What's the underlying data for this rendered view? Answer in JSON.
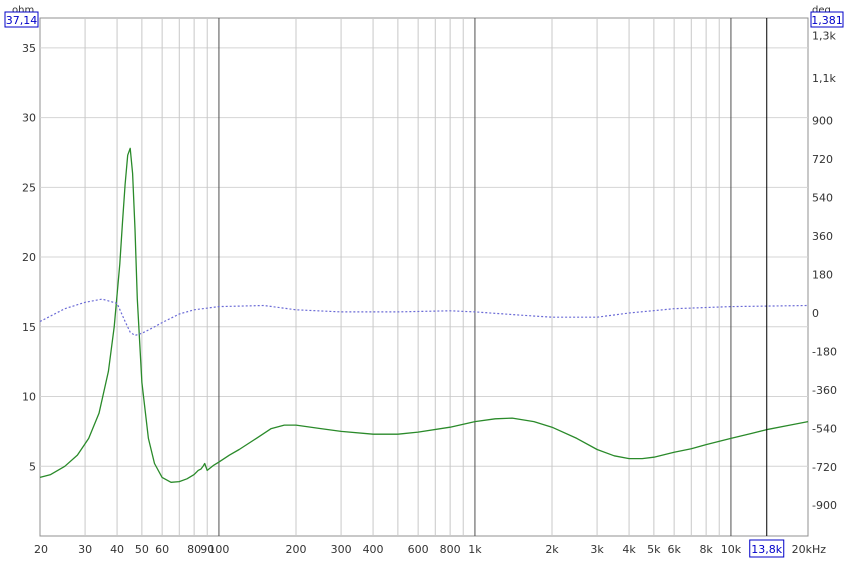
{
  "chart_data": {
    "type": "line",
    "x_axis": {
      "scale": "log",
      "range_hz": [
        20,
        20000
      ],
      "ticks": [
        {
          "value": 20,
          "label": "20"
        },
        {
          "value": 30,
          "label": "30"
        },
        {
          "value": 40,
          "label": "40"
        },
        {
          "value": 50,
          "label": "50"
        },
        {
          "value": 60,
          "label": "60"
        },
        {
          "value": 80,
          "label": "80"
        },
        {
          "value": 90,
          "label": "90"
        },
        {
          "value": 100,
          "label": "100"
        },
        {
          "value": 200,
          "label": "200"
        },
        {
          "value": 300,
          "label": "300"
        },
        {
          "value": 400,
          "label": "400"
        },
        {
          "value": 600,
          "label": "600"
        },
        {
          "value": 800,
          "label": "800"
        },
        {
          "value": 1000,
          "label": "1k"
        },
        {
          "value": 2000,
          "label": "2k"
        },
        {
          "value": 3000,
          "label": "3k"
        },
        {
          "value": 4000,
          "label": "4k"
        },
        {
          "value": 5000,
          "label": "5k"
        },
        {
          "value": 6000,
          "label": "6k"
        },
        {
          "value": 8000,
          "label": "8k"
        },
        {
          "value": 10000,
          "label": "10k"
        },
        {
          "value": 20000,
          "label": "20kHz"
        }
      ],
      "minor_grid": [
        70,
        500,
        700,
        900,
        7000,
        9000
      ],
      "major_grid": [
        100,
        1000,
        10000
      ],
      "cursor": {
        "value": 13800,
        "label": "13,8k"
      }
    },
    "y_axis_left": {
      "unit": "ohm",
      "range": [
        0,
        37.14
      ],
      "top_value_label": "37,14",
      "ticks": [
        5,
        10,
        15,
        20,
        25,
        30,
        35
      ],
      "tick_labels": [
        "5",
        "10",
        "15",
        "20",
        "25",
        "30",
        "35"
      ]
    },
    "y_axis_right": {
      "unit": "deg",
      "range": [
        -1044.15,
        1381
      ],
      "top_value_label": "1,381",
      "ticks": [
        -900,
        -720,
        -540,
        -360,
        -180,
        0,
        180,
        360,
        540,
        720,
        900,
        1100,
        1300
      ],
      "tick_labels": [
        "-900",
        "-720",
        "-540",
        "-360",
        "-180",
        "0",
        "180",
        "360",
        "540",
        "720",
        "900",
        "1,1k",
        "1,3k"
      ]
    },
    "series": [
      {
        "axis": "left",
        "style": "solid",
        "color": "#2a8a2a",
        "x": [
          20,
          22,
          25,
          28,
          31,
          34,
          37,
          39,
          41,
          42,
          43,
          44,
          45,
          46,
          47,
          48,
          50,
          53,
          56,
          60,
          65,
          70,
          75,
          80,
          83,
          85,
          87,
          88,
          90,
          92,
          95,
          100,
          110,
          120,
          140,
          160,
          180,
          200,
          250,
          300,
          400,
          500,
          600,
          800,
          1000,
          1200,
          1400,
          1700,
          2000,
          2500,
          3000,
          3500,
          4000,
          4500,
          5000,
          6000,
          7000,
          8000,
          10000,
          12000,
          14000,
          17000,
          20000
        ],
        "y": [
          4.2,
          4.4,
          5.0,
          5.8,
          7.0,
          8.8,
          11.8,
          15.0,
          19.5,
          22.5,
          25.2,
          27.3,
          27.8,
          26.0,
          22.0,
          17.0,
          11.0,
          7.0,
          5.2,
          4.2,
          3.85,
          3.9,
          4.1,
          4.4,
          4.7,
          4.8,
          5.05,
          5.2,
          4.7,
          4.85,
          5.05,
          5.3,
          5.8,
          6.2,
          7.0,
          7.7,
          7.95,
          7.95,
          7.7,
          7.5,
          7.3,
          7.3,
          7.45,
          7.8,
          8.2,
          8.4,
          8.45,
          8.2,
          7.8,
          7.0,
          6.2,
          5.75,
          5.55,
          5.55,
          5.65,
          6.0,
          6.25,
          6.55,
          7.0,
          7.35,
          7.65,
          7.95,
          8.2
        ]
      },
      {
        "axis": "right",
        "style": "dotted",
        "color": "#6b6bd6",
        "x": [
          20,
          25,
          30,
          35,
          40,
          43,
          45,
          47,
          50,
          55,
          60,
          70,
          80,
          100,
          150,
          200,
          300,
          500,
          800,
          1000,
          1500,
          2000,
          3000,
          4000,
          6000,
          10000,
          20000
        ],
        "y": [
          -40,
          20,
          50,
          65,
          45,
          -40,
          -90,
          -105,
          -95,
          -70,
          -45,
          -5,
          15,
          30,
          35,
          15,
          5,
          5,
          10,
          5,
          -10,
          -20,
          -20,
          0,
          20,
          30,
          35
        ]
      }
    ]
  }
}
